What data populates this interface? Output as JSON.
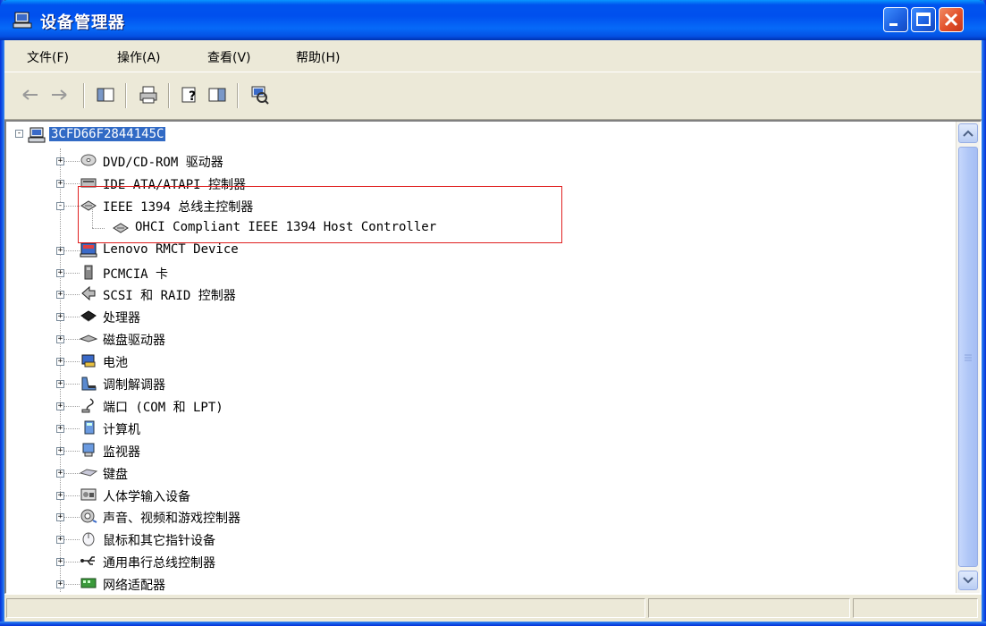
{
  "window": {
    "title": "设备管理器"
  },
  "menu": [
    {
      "label": "文件(F)"
    },
    {
      "label": "操作(A)"
    },
    {
      "label": "查看(V)"
    },
    {
      "label": "帮助(H)"
    }
  ],
  "toolbar": {
    "buttons": [
      "back-arrow-icon",
      "forward-arrow-icon",
      "show-hide-console-tree-icon",
      "print-icon",
      "help-icon",
      "properties-icon",
      "scan-hardware-icon"
    ]
  },
  "tree": {
    "root": "3CFD66F2844145C",
    "items": [
      {
        "label": "DVD/CD-ROM 驱动器",
        "icon": "cdrom-icon",
        "expander": "+"
      },
      {
        "label": "IDE ATA/ATAPI 控制器",
        "icon": "ide-controller-icon",
        "expander": "+"
      },
      {
        "label": "IEEE 1394 总线主控制器",
        "icon": "ieee1394-icon",
        "expander": "-"
      },
      {
        "label": "OHCI Compliant IEEE 1394 Host Controller",
        "icon": "ieee1394-device-icon",
        "child": true
      },
      {
        "label": "Lenovo RMCT Device",
        "icon": "lenovo-device-icon",
        "expander": "+"
      },
      {
        "label": "PCMCIA 卡",
        "icon": "pcmcia-icon",
        "expander": "+"
      },
      {
        "label": "SCSI 和 RAID 控制器",
        "icon": "scsi-icon",
        "expander": "+"
      },
      {
        "label": "处理器",
        "icon": "processor-icon",
        "expander": "+"
      },
      {
        "label": "磁盘驱动器",
        "icon": "disk-drive-icon",
        "expander": "+"
      },
      {
        "label": "电池",
        "icon": "battery-icon",
        "expander": "+"
      },
      {
        "label": "调制解调器",
        "icon": "modem-icon",
        "expander": "+"
      },
      {
        "label": "端口 (COM 和 LPT)",
        "icon": "port-icon",
        "expander": "+"
      },
      {
        "label": "计算机",
        "icon": "computer-icon",
        "expander": "+"
      },
      {
        "label": "监视器",
        "icon": "monitor-icon",
        "expander": "+"
      },
      {
        "label": "键盘",
        "icon": "keyboard-icon",
        "expander": "+"
      },
      {
        "label": "人体学输入设备",
        "icon": "hid-icon",
        "expander": "+"
      },
      {
        "label": "声音、视频和游戏控制器",
        "icon": "sound-icon",
        "expander": "+"
      },
      {
        "label": "鼠标和其它指针设备",
        "icon": "mouse-icon",
        "expander": "+"
      },
      {
        "label": "通用串行总线控制器",
        "icon": "usb-icon",
        "expander": "+"
      },
      {
        "label": "网络适配器",
        "icon": "network-adapter-icon",
        "expander": "+"
      }
    ]
  },
  "colors": {
    "selection": "#316ac5",
    "highlight_box": "#e02020",
    "chrome": "#ece9d8",
    "titlebar": "#0053ee"
  }
}
